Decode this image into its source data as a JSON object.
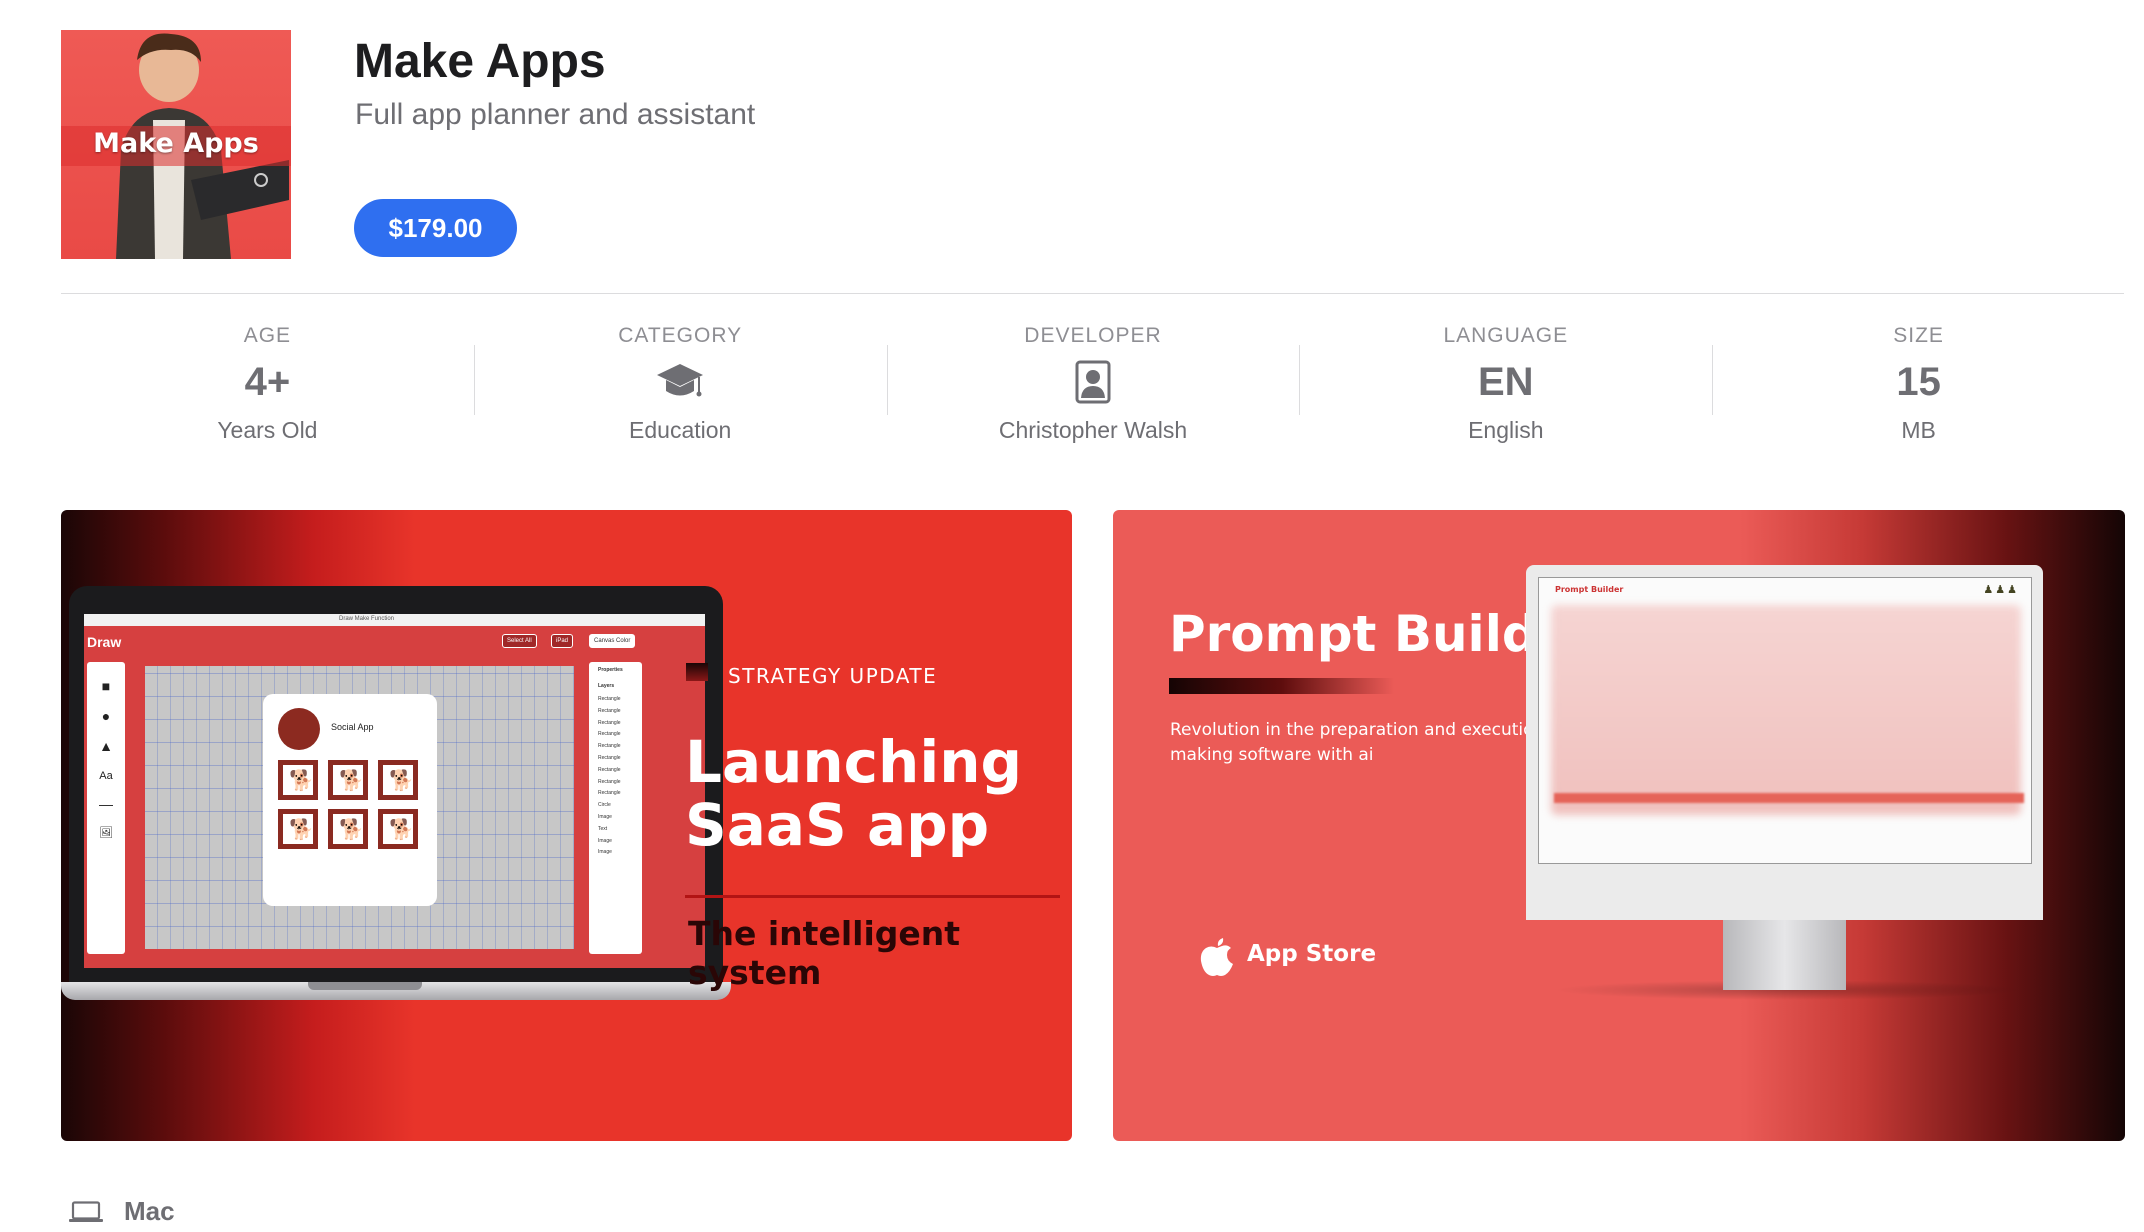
{
  "app": {
    "icon_text": "Make Apps",
    "title": "Make Apps",
    "subtitle": "Full app planner and assistant",
    "price": "$179.00"
  },
  "info": [
    {
      "label": "AGE",
      "value": "4+",
      "sub": "Years Old"
    },
    {
      "label": "CATEGORY",
      "icon": "graduation-cap-icon",
      "sub": "Education"
    },
    {
      "label": "DEVELOPER",
      "icon": "person-portrait-icon",
      "sub": "Christopher Walsh"
    },
    {
      "label": "LANGUAGE",
      "value": "EN",
      "sub": "English"
    },
    {
      "label": "SIZE",
      "value": "15",
      "sub": "MB"
    }
  ],
  "screenshot1": {
    "tag": "STRATEGY UPDATE",
    "headline": "Launching\nSaaS app",
    "tagline": "The intelligent system",
    "screen": {
      "title": "Draw",
      "tabs": "Draw     Make     Function",
      "buttons": [
        "Select All",
        "iPad",
        "Canvas Color"
      ],
      "tools": [
        "■",
        "●",
        "▲",
        "Aa",
        "—",
        "🖼"
      ],
      "card_label": "Social App",
      "panel_title": "Properties",
      "panel_sub": "Layers",
      "layers": [
        "Rectangle",
        "Rectangle",
        "Rectangle",
        "Rectangle",
        "Rectangle",
        "Rectangle",
        "Rectangle",
        "Rectangle",
        "Rectangle",
        "Circle",
        "Image",
        "Text",
        "Image",
        "Image"
      ]
    }
  },
  "screenshot2": {
    "title": "Prompt Builder",
    "description": "Revolution in the preparation and execution making software with ai",
    "store_label": "App Store",
    "screen_title": "Prompt Builder"
  },
  "platform": {
    "label": "Mac",
    "icon": "laptop-icon"
  }
}
